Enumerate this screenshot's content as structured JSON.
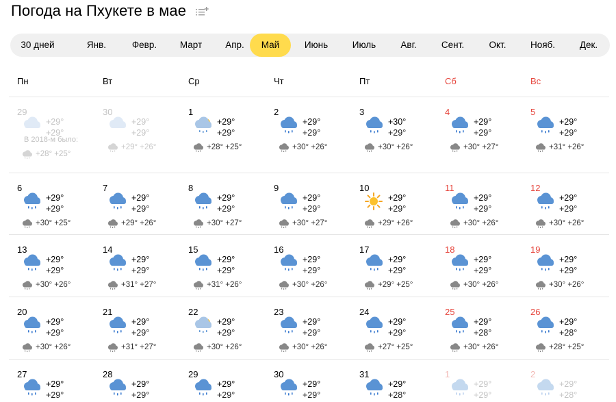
{
  "header": {
    "title": "Погода на Пхукете в мае",
    "icon": "list-add-icon"
  },
  "months": [
    {
      "label": "30 дней",
      "active": false
    },
    {
      "label": "Янв.",
      "active": false
    },
    {
      "label": "Февр.",
      "active": false
    },
    {
      "label": "Март",
      "active": false
    },
    {
      "label": "Апр.",
      "active": false
    },
    {
      "label": "Май",
      "active": true
    },
    {
      "label": "Июнь",
      "active": false
    },
    {
      "label": "Июль",
      "active": false
    },
    {
      "label": "Авг.",
      "active": false
    },
    {
      "label": "Сент.",
      "active": false
    },
    {
      "label": "Окт.",
      "active": false
    },
    {
      "label": "Нояб.",
      "active": false
    },
    {
      "label": "Дек.",
      "active": false
    }
  ],
  "weekdays": [
    {
      "label": "Пн",
      "weekend": false
    },
    {
      "label": "Вт",
      "weekend": false
    },
    {
      "label": "Ср",
      "weekend": false
    },
    {
      "label": "Чт",
      "weekend": false
    },
    {
      "label": "Пт",
      "weekend": false
    },
    {
      "label": "Сб",
      "weekend": true
    },
    {
      "label": "Вс",
      "weekend": true
    }
  ],
  "history_note": {
    "text": "В 2018-м было:",
    "temps": "+28° +25°",
    "icon": "rain-cloud-icon"
  },
  "colors": {
    "accent": "#ffdb4d",
    "weekend": "#e6453c",
    "muted": "#c4c4c4",
    "tab_bg": "#f0f0f0"
  },
  "weeks": [
    [
      {
        "day": "29",
        "other": true,
        "icon": "cloud-icon",
        "day_temp": "+29°",
        "night_temp": "+29°",
        "hist_icon": "rain-cloud-icon",
        "hist": "",
        "weekend": false
      },
      {
        "day": "30",
        "other": true,
        "icon": "cloud-icon",
        "day_temp": "+29°",
        "night_temp": "+29°",
        "hist_icon": "rain-cloud-icon",
        "hist": "+29° +26°",
        "weekend": false
      },
      {
        "day": "1",
        "other": false,
        "icon": "partly-cloudy-icon",
        "day_temp": "+29°",
        "night_temp": "+29°",
        "hist_icon": "rain-cloud-icon",
        "hist": "+28° +25°",
        "weekend": false
      },
      {
        "day": "2",
        "other": false,
        "icon": "rain-cloud-icon",
        "day_temp": "+29°",
        "night_temp": "+29°",
        "hist_icon": "rain-cloud-icon",
        "hist": "+30° +26°",
        "weekend": false
      },
      {
        "day": "3",
        "other": false,
        "icon": "rain-cloud-icon",
        "day_temp": "+30°",
        "night_temp": "+29°",
        "hist_icon": "rain-cloud-icon",
        "hist": "+30° +26°",
        "weekend": false
      },
      {
        "day": "4",
        "other": false,
        "icon": "rain-cloud-icon",
        "day_temp": "+29°",
        "night_temp": "+29°",
        "hist_icon": "rain-cloud-icon",
        "hist": "+30° +27°",
        "weekend": true
      },
      {
        "day": "5",
        "other": false,
        "icon": "rain-cloud-icon",
        "day_temp": "+29°",
        "night_temp": "+29°",
        "hist_icon": "rain-cloud-icon",
        "hist": "+31° +26°",
        "weekend": true
      }
    ],
    [
      {
        "day": "6",
        "other": false,
        "icon": "rain-cloud-icon",
        "day_temp": "+29°",
        "night_temp": "+29°",
        "hist_icon": "rain-cloud-icon",
        "hist": "+30° +25°",
        "weekend": false
      },
      {
        "day": "7",
        "other": false,
        "icon": "rain-cloud-icon",
        "day_temp": "+29°",
        "night_temp": "+29°",
        "hist_icon": "rain-cloud-icon",
        "hist": "+29° +26°",
        "weekend": false
      },
      {
        "day": "8",
        "other": false,
        "icon": "rain-cloud-icon",
        "day_temp": "+29°",
        "night_temp": "+29°",
        "hist_icon": "rain-cloud-icon",
        "hist": "+30° +27°",
        "weekend": false
      },
      {
        "day": "9",
        "other": false,
        "icon": "rain-cloud-icon",
        "day_temp": "+29°",
        "night_temp": "+29°",
        "hist_icon": "rain-cloud-icon",
        "hist": "+30° +27°",
        "weekend": false
      },
      {
        "day": "10",
        "other": false,
        "icon": "sun-icon",
        "day_temp": "+29°",
        "night_temp": "+29°",
        "hist_icon": "rain-cloud-icon",
        "hist": "+29° +26°",
        "weekend": false
      },
      {
        "day": "11",
        "other": false,
        "icon": "rain-cloud-icon",
        "day_temp": "+29°",
        "night_temp": "+29°",
        "hist_icon": "rain-cloud-icon",
        "hist": "+30° +26°",
        "weekend": true
      },
      {
        "day": "12",
        "other": false,
        "icon": "rain-cloud-icon",
        "day_temp": "+29°",
        "night_temp": "+29°",
        "hist_icon": "rain-cloud-icon",
        "hist": "+30° +26°",
        "weekend": true
      }
    ],
    [
      {
        "day": "13",
        "other": false,
        "icon": "rain-cloud-icon",
        "day_temp": "+29°",
        "night_temp": "+29°",
        "hist_icon": "rain-cloud-icon",
        "hist": "+30° +26°",
        "weekend": false
      },
      {
        "day": "14",
        "other": false,
        "icon": "rain-cloud-icon",
        "day_temp": "+29°",
        "night_temp": "+29°",
        "hist_icon": "rain-cloud-icon",
        "hist": "+31° +27°",
        "weekend": false
      },
      {
        "day": "15",
        "other": false,
        "icon": "rain-cloud-icon",
        "day_temp": "+29°",
        "night_temp": "+29°",
        "hist_icon": "rain-cloud-icon",
        "hist": "+31° +26°",
        "weekend": false
      },
      {
        "day": "16",
        "other": false,
        "icon": "rain-cloud-icon",
        "day_temp": "+29°",
        "night_temp": "+29°",
        "hist_icon": "rain-cloud-icon",
        "hist": "+30° +26°",
        "weekend": false
      },
      {
        "day": "17",
        "other": false,
        "icon": "rain-cloud-icon",
        "day_temp": "+29°",
        "night_temp": "+29°",
        "hist_icon": "rain-cloud-icon",
        "hist": "+29° +25°",
        "weekend": false
      },
      {
        "day": "18",
        "other": false,
        "icon": "rain-cloud-icon",
        "day_temp": "+29°",
        "night_temp": "+29°",
        "hist_icon": "rain-cloud-icon",
        "hist": "+30° +26°",
        "weekend": true
      },
      {
        "day": "19",
        "other": false,
        "icon": "rain-cloud-icon",
        "day_temp": "+29°",
        "night_temp": "+29°",
        "hist_icon": "rain-cloud-icon",
        "hist": "+30° +26°",
        "weekend": true
      }
    ],
    [
      {
        "day": "20",
        "other": false,
        "icon": "rain-cloud-icon",
        "day_temp": "+29°",
        "night_temp": "+29°",
        "hist_icon": "rain-cloud-icon",
        "hist": "+30° +26°",
        "weekend": false
      },
      {
        "day": "21",
        "other": false,
        "icon": "rain-cloud-icon",
        "day_temp": "+29°",
        "night_temp": "+29°",
        "hist_icon": "rain-cloud-icon",
        "hist": "+31° +27°",
        "weekend": false
      },
      {
        "day": "22",
        "other": false,
        "icon": "partly-cloudy-icon",
        "day_temp": "+29°",
        "night_temp": "+29°",
        "hist_icon": "rain-cloud-icon",
        "hist": "+30° +26°",
        "weekend": false
      },
      {
        "day": "23",
        "other": false,
        "icon": "rain-cloud-icon",
        "day_temp": "+29°",
        "night_temp": "+29°",
        "hist_icon": "rain-cloud-icon",
        "hist": "+30° +26°",
        "weekend": false
      },
      {
        "day": "24",
        "other": false,
        "icon": "rain-cloud-icon",
        "day_temp": "+29°",
        "night_temp": "+29°",
        "hist_icon": "rain-cloud-icon",
        "hist": "+27° +25°",
        "weekend": false
      },
      {
        "day": "25",
        "other": false,
        "icon": "rain-cloud-icon",
        "day_temp": "+29°",
        "night_temp": "+28°",
        "hist_icon": "rain-cloud-icon",
        "hist": "+30° +26°",
        "weekend": true
      },
      {
        "day": "26",
        "other": false,
        "icon": "rain-cloud-icon",
        "day_temp": "+29°",
        "night_temp": "+28°",
        "hist_icon": "rain-cloud-icon",
        "hist": "+28° +25°",
        "weekend": true
      }
    ],
    [
      {
        "day": "27",
        "other": false,
        "icon": "rain-cloud-icon",
        "day_temp": "+29°",
        "night_temp": "+29°",
        "hist_icon": "rain-cloud-icon",
        "hist": "",
        "weekend": false
      },
      {
        "day": "28",
        "other": false,
        "icon": "rain-cloud-icon",
        "day_temp": "+29°",
        "night_temp": "+29°",
        "hist_icon": "rain-cloud-icon",
        "hist": "",
        "weekend": false
      },
      {
        "day": "29",
        "other": false,
        "icon": "rain-cloud-icon",
        "day_temp": "+29°",
        "night_temp": "+29°",
        "hist_icon": "rain-cloud-icon",
        "hist": "",
        "weekend": false
      },
      {
        "day": "30",
        "other": false,
        "icon": "rain-cloud-icon",
        "day_temp": "+29°",
        "night_temp": "+29°",
        "hist_icon": "rain-cloud-icon",
        "hist": "",
        "weekend": false
      },
      {
        "day": "31",
        "other": false,
        "icon": "rain-cloud-icon",
        "day_temp": "+29°",
        "night_temp": "+28°",
        "hist_icon": "rain-cloud-icon",
        "hist": "",
        "weekend": false
      },
      {
        "day": "1",
        "other": true,
        "icon": "rain-cloud-icon",
        "day_temp": "+29°",
        "night_temp": "+29°",
        "hist_icon": "rain-cloud-icon",
        "hist": "",
        "weekend": true
      },
      {
        "day": "2",
        "other": true,
        "icon": "rain-cloud-icon",
        "day_temp": "+29°",
        "night_temp": "+28°",
        "hist_icon": "rain-cloud-icon",
        "hist": "",
        "weekend": true
      }
    ]
  ]
}
